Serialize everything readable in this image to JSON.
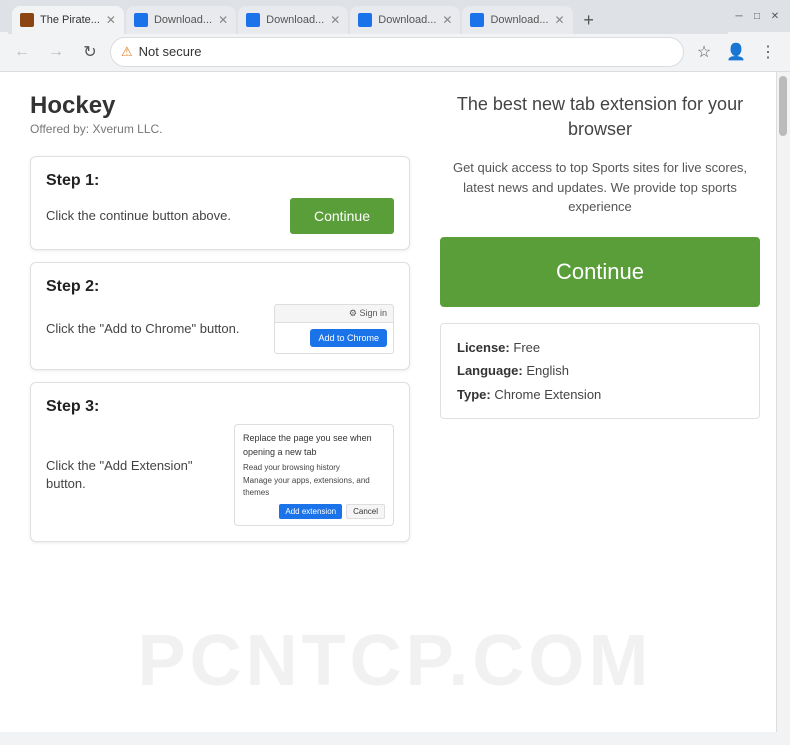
{
  "browser": {
    "tabs": [
      {
        "label": "The Pirate...",
        "active": true,
        "favicon": "pirate"
      },
      {
        "label": "Download...",
        "active": false,
        "favicon": "download"
      },
      {
        "label": "Download...",
        "active": false,
        "favicon": "download"
      },
      {
        "label": "Download...",
        "active": false,
        "favicon": "download"
      },
      {
        "label": "Download...",
        "active": false,
        "favicon": "download"
      }
    ],
    "address": "Not secure",
    "new_tab_label": "+",
    "nav": {
      "back": "←",
      "forward": "→",
      "refresh": "↻"
    }
  },
  "page": {
    "extension": {
      "name": "Hockey",
      "offered_by": "Offered by: Xverum LLC."
    },
    "tagline": "The best new tab extension for your browser",
    "description": "Get quick access to top Sports sites for live scores, latest news and updates. We provide top sports experience",
    "continue_btn_label": "Continue",
    "big_continue_btn_label": "Continue",
    "steps": [
      {
        "title": "Step 1:",
        "text": "Click the continue button above.",
        "action_label": "Continue"
      },
      {
        "title": "Step 2:",
        "text": "Click the \"Add to Chrome\" button.",
        "action_label": "Add to Chrome"
      },
      {
        "title": "Step 3:",
        "text": "Click the \"Add Extension\" button.",
        "dialog": {
          "line1": "Replace the page you see when opening a new tab",
          "line2": "Read your browsing history",
          "line3": "Manage your apps, extensions, and themes",
          "add_btn": "Add extension",
          "cancel_btn": "Cancel"
        }
      }
    ],
    "info": {
      "license_label": "License:",
      "license_value": "Free",
      "language_label": "Language:",
      "language_value": "English",
      "type_label": "Type:",
      "type_value": "Chrome Extension"
    },
    "watermark": "PCNTCP.COM"
  },
  "colors": {
    "green": "#5a9e3a",
    "blue": "#1a73e8"
  }
}
